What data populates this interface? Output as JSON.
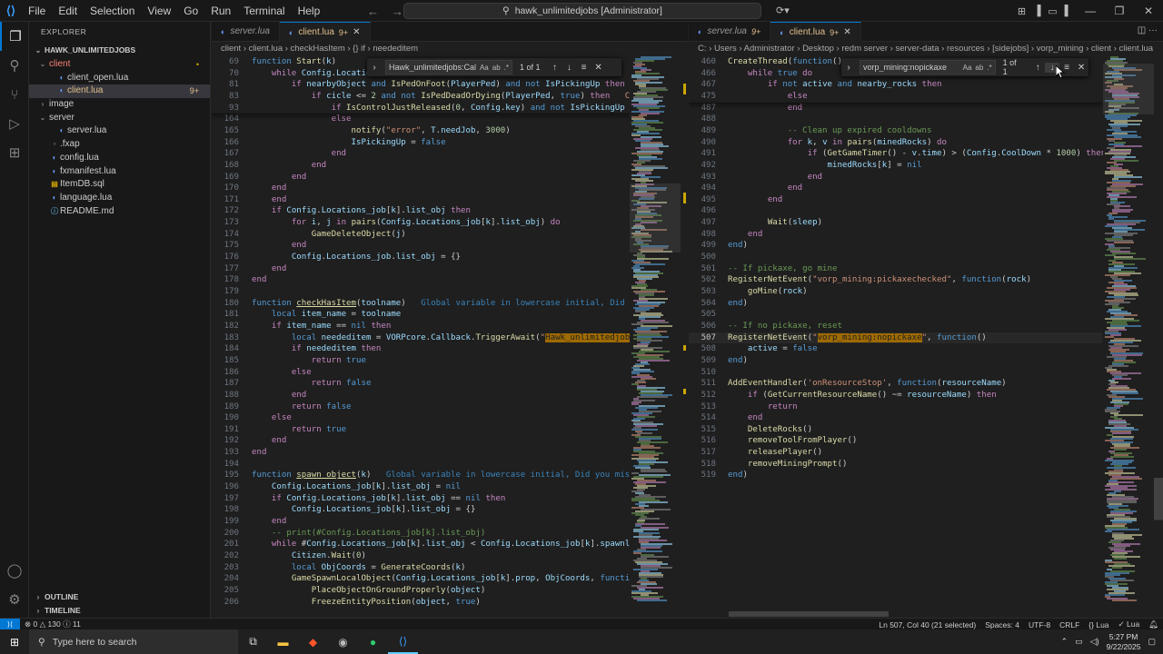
{
  "titlebar": {
    "menu": [
      "File",
      "Edit",
      "Selection",
      "View",
      "Go",
      "Run",
      "Terminal",
      "Help"
    ],
    "search_text": "hawk_unlimitedjobs [Administrator]"
  },
  "explorer": {
    "title": "EXPLORER",
    "root": "HAWK_UNLIMITEDJOBS",
    "items": [
      {
        "label": "client",
        "kind": "folder-open",
        "indent": 1,
        "cls": "tr-err",
        "badge": "•"
      },
      {
        "label": "client_open.lua",
        "kind": "lua",
        "indent": 2,
        "cls": "",
        "badge": ""
      },
      {
        "label": "client.lua",
        "kind": "lua",
        "indent": 2,
        "cls": "tr-mod",
        "badge": "9+",
        "selected": true
      },
      {
        "label": "image",
        "kind": "folder",
        "indent": 1,
        "cls": "",
        "badge": ""
      },
      {
        "label": "server",
        "kind": "folder-open",
        "indent": 1,
        "cls": "",
        "badge": ""
      },
      {
        "label": "server.lua",
        "kind": "lua",
        "indent": 2,
        "cls": "",
        "badge": ""
      },
      {
        "label": ".fxap",
        "kind": "fx",
        "indent": 1,
        "cls": "",
        "badge": ""
      },
      {
        "label": "config.lua",
        "kind": "lua",
        "indent": 1,
        "cls": "",
        "badge": ""
      },
      {
        "label": "fxmanifest.lua",
        "kind": "lua",
        "indent": 1,
        "cls": "",
        "badge": ""
      },
      {
        "label": "ItemDB.sql",
        "kind": "sql",
        "indent": 1,
        "cls": "",
        "badge": ""
      },
      {
        "label": "language.lua",
        "kind": "lua",
        "indent": 1,
        "cls": "",
        "badge": ""
      },
      {
        "label": "README.md",
        "kind": "md",
        "indent": 1,
        "cls": "",
        "badge": ""
      }
    ],
    "outline": "OUTLINE",
    "timeline": "TIMELINE"
  },
  "left_editor": {
    "tabs": [
      {
        "label": "server.lua",
        "active": false,
        "dirty": ""
      },
      {
        "label": "client.lua",
        "active": true,
        "dirty": "9+"
      }
    ],
    "breadcrumb": "client  ›  client.lua  ›  checkHasItem  ›  {} if  ›  neededitem",
    "find": {
      "query": "Hawk_unlimitedjobs:Callb",
      "count": "1 of 1"
    },
    "sticky": [
      {
        "n": "69",
        "html": "<span class='kw'>function</span> <span class='fn'>Start</span>(<span class='va'>k</span>)"
      },
      {
        "n": "70",
        "html": "    <span class='ctl'>while</span> <span class='va'>Config</span>.<span class='va'>Locatio</span>"
      },
      {
        "n": "81",
        "html": "        <span class='ctl'>if</span> <span class='va'>nearbyObject</span> <span class='kw'>and</span> <span class='fn'>IsPedOnFoot</span>(<span class='va'>PlayerPed</span>) <span class='kw'>and</span> <span class='kw'>not</span> <span class='va'>IsPickingUp</span> <span class='ctl'>then</span>"
      },
      {
        "n": "83",
        "html": "            <span class='ctl'>if</span> <span class='va'>cicle</span> &lt;= <span class='num'>2</span> <span class='kw'>and</span> <span class='kw'>not</span> <span class='fn'>IsPedDeadOrDying</span>(<span class='va'>PlayerPed</span>, <span class='kw'>true</span>) <span class='ctl'>then</span>   <span class='str'>Cann</span>"
      },
      {
        "n": "93",
        "html": "                <span class='ctl'>if</span> <span class='fn'>IsControlJustReleased</span>(<span class='num'>0</span>, <span class='va'>Config</span>.<span class='va'>key</span>) <span class='kw'>and</span> <span class='kw'>not</span> <span class='va'>IsPickingUp</span> <span class='ctl'>then</span>"
      }
    ],
    "lines": [
      {
        "n": "164",
        "html": "                <span class='ctl'>else</span>"
      },
      {
        "n": "165",
        "html": "                    <span class='fn'>notify</span>(<span class='str'>\"error\"</span>, <span class='va'>T</span>.<span class='va'>needJob</span>, <span class='num'>3000</span>)"
      },
      {
        "n": "166",
        "html": "                    <span class='va'>IsPickingUp</span> = <span class='kw'>false</span>"
      },
      {
        "n": "167",
        "html": "                <span class='ctl'>end</span>"
      },
      {
        "n": "168",
        "html": "            <span class='ctl'>end</span>"
      },
      {
        "n": "169",
        "html": "        <span class='ctl'>end</span>"
      },
      {
        "n": "170",
        "html": "    <span class='ctl'>end</span>"
      },
      {
        "n": "171",
        "html": "    <span class='ctl'>end</span>"
      },
      {
        "n": "172",
        "html": "    <span class='ctl'>if</span> <span class='va'>Config</span>.<span class='va'>Locations_job</span>[<span class='va'>k</span>].<span class='va'>list_obj</span> <span class='ctl'>then</span>"
      },
      {
        "n": "173",
        "html": "        <span class='ctl'>for</span> <span class='va'>i</span>, <span class='va'>j</span> <span class='ctl'>in</span> <span class='fn'>pairs</span>(<span class='va'>Config</span>.<span class='va'>Locations_job</span>[<span class='va'>k</span>].<span class='va'>list_obj</span>) <span class='ctl'>do</span>"
      },
      {
        "n": "174",
        "html": "            <span class='fn'>GameDeleteObject</span>(<span class='va'>j</span>)"
      },
      {
        "n": "175",
        "html": "        <span class='ctl'>end</span>"
      },
      {
        "n": "176",
        "html": "        <span class='va'>Config</span>.<span class='va'>Locations_job</span>.<span class='va'>list_obj</span> = {}"
      },
      {
        "n": "177",
        "html": "    <span class='ctl'>end</span>"
      },
      {
        "n": "178",
        "html": "<span class='ctl'>end</span>"
      },
      {
        "n": "179",
        "html": ""
      },
      {
        "n": "180",
        "html": "<span class='kw'>function</span> <span class='fn' style='text-decoration:underline'>checkHasItem</span>(<span class='va'>toolname</span>)   <span class='hint'>Global variable in lowercase initial, Did you</span>"
      },
      {
        "n": "181",
        "html": "    <span class='kw'>local</span> <span class='va'>item_name</span> = <span class='va'>toolname</span>"
      },
      {
        "n": "182",
        "html": "    <span class='ctl'>if</span> <span class='va'>item_name</span> == <span class='kw'>nil</span> <span class='ctl'>then</span>"
      },
      {
        "n": "183",
        "html": "        <span class='kw'>local</span> <span class='va'>neededitem</span> = <span class='va'>VORPcore</span>.<span class='va'>Callback</span>.<span class='fn'>TriggerAwait</span>(<span class='str'>\"<span style='background:#9e6a03;color:#1f1f1f'>Hawk_unlimitedjobs:Call</span></span>"
      },
      {
        "n": "184",
        "html": "        <span class='ctl'>if</span> <span class='va'>neededitem</span> <span class='ctl'>then</span>"
      },
      {
        "n": "185",
        "html": "            <span class='ctl'>return</span> <span class='kw'>true</span>"
      },
      {
        "n": "186",
        "html": "        <span class='ctl'>else</span>"
      },
      {
        "n": "187",
        "html": "            <span class='ctl'>return</span> <span class='kw'>false</span>"
      },
      {
        "n": "188",
        "html": "        <span class='ctl'>end</span>"
      },
      {
        "n": "189",
        "html": "        <span class='ctl'>return</span> <span class='kw'>false</span>"
      },
      {
        "n": "190",
        "html": "    <span class='ctl'>else</span>"
      },
      {
        "n": "191",
        "html": "        <span class='ctl'>return</span> <span class='kw'>true</span>"
      },
      {
        "n": "192",
        "html": "    <span class='ctl'>end</span>"
      },
      {
        "n": "193",
        "html": "<span class='ctl'>end</span>"
      },
      {
        "n": "194",
        "html": ""
      },
      {
        "n": "195",
        "html": "<span class='kw'>function</span> <span class='fn' style='text-decoration:underline'>spawn_object</span>(<span class='va'>k</span>)   <span class='hint'>Global variable in lowercase initial, Did you miss `</span>"
      },
      {
        "n": "196",
        "html": "    <span class='va'>Config</span>.<span class='va'>Locations_job</span>[<span class='va'>k</span>].<span class='va'>list_obj</span> = <span class='kw'>nil</span>"
      },
      {
        "n": "197",
        "html": "    <span class='ctl'>if</span> <span class='va'>Config</span>.<span class='va'>Locations_job</span>[<span class='va'>k</span>].<span class='va'>list_obj</span> == <span class='kw'>nil</span> <span class='ctl'>then</span>"
      },
      {
        "n": "198",
        "html": "        <span class='va'>Config</span>.<span class='va'>Locations_job</span>[<span class='va'>k</span>].<span class='va'>list_obj</span> = {}"
      },
      {
        "n": "199",
        "html": "    <span class='ctl'>end</span>"
      },
      {
        "n": "200",
        "html": "    <span class='cm'>-- print(#Config.Locations_job[k].list_obj)</span>"
      },
      {
        "n": "201",
        "html": "    <span class='ctl'>while</span> #<span class='va'>Config</span>.<span class='va'>Locations_job</span>[<span class='va'>k</span>].<span class='va'>list_obj</span> &lt; <span class='va'>Config</span>.<span class='va'>Locations_job</span>[<span class='va'>k</span>].<span class='va'>spawnlimit</span>"
      },
      {
        "n": "202",
        "html": "        <span class='va'>Citizen</span>.<span class='fn'>Wait</span>(<span class='num'>0</span>)"
      },
      {
        "n": "203",
        "html": "        <span class='kw'>local</span> <span class='va'>ObjCoords</span> = <span class='fn'>GenerateCoords</span>(<span class='va'>k</span>)"
      },
      {
        "n": "204",
        "html": "        <span class='fn'>GameSpawnLocalObject</span>(<span class='va'>Config</span>.<span class='va'>Locations_job</span>[<span class='va'>k</span>].<span class='va'>prop</span>, <span class='va'>ObjCoords</span>, <span class='kw'>function</span>(<span class='va'>o</span>"
      },
      {
        "n": "205",
        "html": "            <span class='fn'>PlaceObjectOnGroundProperly</span>(<span class='va'>object</span>)"
      },
      {
        "n": "206",
        "html": "            <span class='fn'>FreezeEntityPosition</span>(<span class='va'>object</span>, <span class='kw'>true</span>)"
      }
    ]
  },
  "right_editor": {
    "tabs": [
      {
        "label": "server.lua",
        "active": false,
        "dirty": "9+"
      },
      {
        "label": "client.lua",
        "active": true,
        "dirty": "9+"
      }
    ],
    "breadcrumb": "C: › Users › Administrator › Desktop › redm server › server-data › resources › [sidejobs] › vorp_mining › client › client.lua",
    "find": {
      "query": "vorp_mining:nopickaxe",
      "count": "1 of 1"
    },
    "sticky": [
      {
        "n": "460",
        "html": "<span class='fn'>CreateThread</span>(<span class='kw'>function</span>()"
      },
      {
        "n": "466",
        "html": "    <span class='ctl'>while</span> <span class='kw'>true</span> <span class='ctl'>do</span>"
      },
      {
        "n": "467",
        "html": "        <span class='ctl'>if</span> <span class='kw'>not</span> <span class='va'>active</span> <span class='kw'>and</span> <span class='va'>nearby_rocks</span> <span class='ctl'>then</span>"
      },
      {
        "n": "475",
        "html": "            <span class='ctl'>else</span>"
      }
    ],
    "lines": [
      {
        "n": "487",
        "html": "            <span class='ctl'>end</span>"
      },
      {
        "n": "488",
        "html": ""
      },
      {
        "n": "489",
        "html": "            <span class='cm'>-- Clean up expired cooldowns</span>"
      },
      {
        "n": "490",
        "html": "            <span class='ctl'>for</span> <span class='va'>k</span>, <span class='va'>v</span> <span class='ctl'>in</span> <span class='fn'>pairs</span>(<span class='va'>minedRocks</span>) <span class='ctl'>do</span>"
      },
      {
        "n": "491",
        "html": "                <span class='ctl'>if</span> (<span class='fn'>GetGameTimer</span>() - <span class='va'>v</span>.<span class='va'>time</span>) &gt; (<span class='va'>Config</span>.<span class='va'>CoolDown</span> * <span class='num'>1000</span>) <span class='ctl'>then</span>"
      },
      {
        "n": "492",
        "html": "                    <span class='va'>minedRocks</span>[<span class='va'>k</span>] = <span class='kw'>nil</span>"
      },
      {
        "n": "493",
        "html": "                <span class='ctl'>end</span>"
      },
      {
        "n": "494",
        "html": "            <span class='ctl'>end</span>"
      },
      {
        "n": "495",
        "html": "        <span class='ctl'>end</span>"
      },
      {
        "n": "496",
        "html": ""
      },
      {
        "n": "497",
        "html": "        <span class='fn'>Wait</span>(<span class='va'>sleep</span>)"
      },
      {
        "n": "498",
        "html": "    <span class='ctl'>end</span>"
      },
      {
        "n": "499",
        "html": "<span class='kw'>end</span>)"
      },
      {
        "n": "500",
        "html": ""
      },
      {
        "n": "501",
        "html": "<span class='cm'>-- If pickaxe, go mine</span>"
      },
      {
        "n": "502",
        "html": "<span class='fn'>RegisterNetEvent</span>(<span class='str'>\"vorp_mining:pickaxechecked\"</span>, <span class='kw'>function</span>(<span class='va'>rock</span>)"
      },
      {
        "n": "503",
        "html": "    <span class='fn'>goMine</span>(<span class='va'>rock</span>)"
      },
      {
        "n": "504",
        "html": "<span class='kw'>end</span>)"
      },
      {
        "n": "505",
        "html": ""
      },
      {
        "n": "506",
        "html": "<span class='cm'>-- If no pickaxe, reset</span>"
      },
      {
        "n": "507",
        "html": "<span class='fn'>RegisterNetEvent</span>(<span class='str'>\"<span style='background:#9e6a03;color:#1f1f1f'>vorp_mining:nopickaxe</span>\"</span>, <span class='kw'>function</span>()",
        "cur": true
      },
      {
        "n": "508",
        "html": "    <span class='va'>active</span> = <span class='kw'>false</span>"
      },
      {
        "n": "509",
        "html": "<span class='kw'>end</span>)"
      },
      {
        "n": "510",
        "html": ""
      },
      {
        "n": "511",
        "html": "<span class='fn'>AddEventHandler</span>(<span class='str'>'onResourceStop'</span>, <span class='kw'>function</span>(<span class='va'>resourceName</span>)"
      },
      {
        "n": "512",
        "html": "    <span class='ctl'>if</span> (<span class='fn'>GetCurrentResourceName</span>() ~= <span class='va'>resourceName</span>) <span class='ctl'>then</span>"
      },
      {
        "n": "513",
        "html": "        <span class='ctl'>return</span>"
      },
      {
        "n": "514",
        "html": "    <span class='ctl'>end</span>"
      },
      {
        "n": "515",
        "html": "    <span class='fn'>DeleteRocks</span>()"
      },
      {
        "n": "516",
        "html": "    <span class='fn'>removeToolFromPlayer</span>()"
      },
      {
        "n": "517",
        "html": "    <span class='fn'>releasePlayer</span>()"
      },
      {
        "n": "518",
        "html": "    <span class='fn'>removeMiningPrompt</span>()"
      },
      {
        "n": "519",
        "html": "<span class='kw'>end</span>)"
      }
    ]
  },
  "status": {
    "errors": "0",
    "warnings": "130",
    "info": "11",
    "position": "Ln 507, Col 40 (21 selected)",
    "spaces": "Spaces: 4",
    "encoding": "UTF-8",
    "eol": "CRLF",
    "lang": "Lua",
    "lang2": "Lua"
  },
  "taskbar": {
    "search": "Type here to search",
    "time": "5:27 PM",
    "date": "9/22/2025"
  }
}
